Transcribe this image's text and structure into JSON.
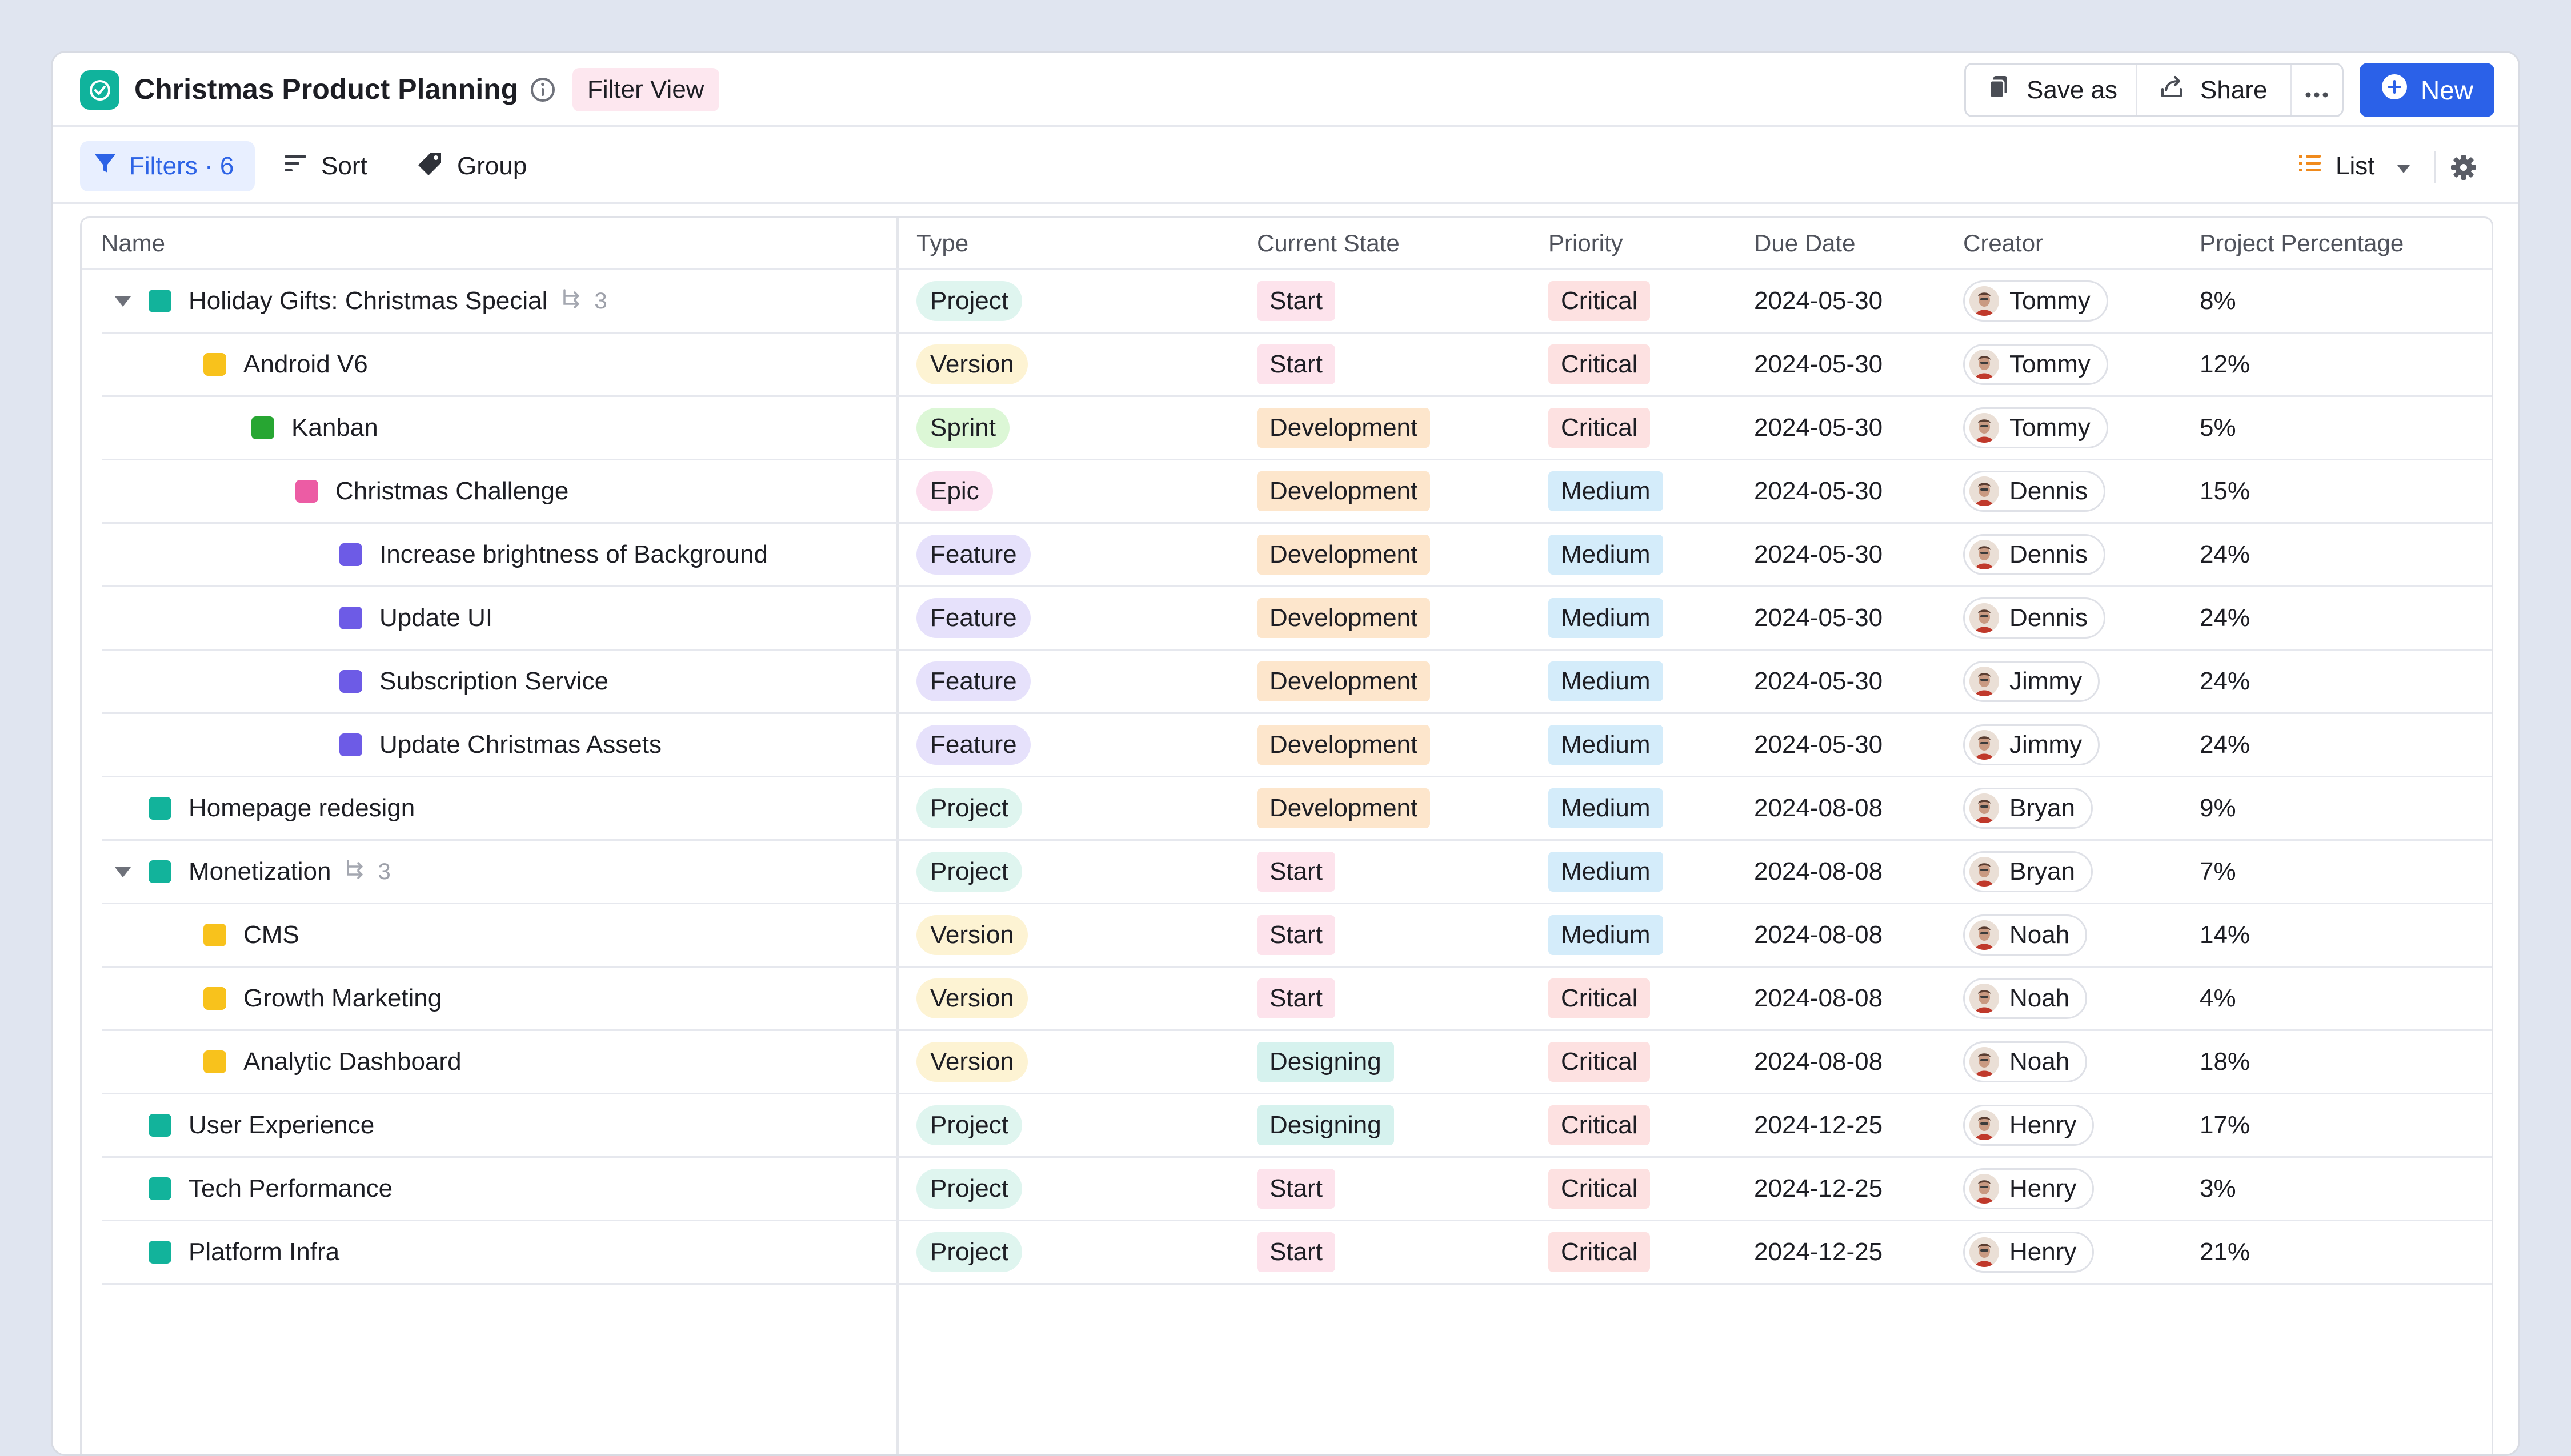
{
  "header": {
    "title": "Christmas Product Planning",
    "view_label": "Filter View",
    "save_as": "Save as",
    "share": "Share",
    "new": "New",
    "accent": "#2b61e8",
    "app_color": "#10b39c"
  },
  "toolbar": {
    "filters": "Filters · 6",
    "sort": "Sort",
    "group": "Group",
    "view": "List"
  },
  "columns": [
    "Name",
    "Type",
    "Current State",
    "Priority",
    "Due Date",
    "Creator",
    "Project Percentage"
  ],
  "styles": {
    "type": {
      "Project": {
        "bg": "#dff5ef",
        "fg": "#1d1e24",
        "square": "#12b39b"
      },
      "Version": {
        "bg": "#fdf3d3",
        "fg": "#1d1e24",
        "square": "#f8c21c"
      },
      "Sprint": {
        "bg": "#dcf7d6",
        "fg": "#1d1e24",
        "square": "#27a632"
      },
      "Epic": {
        "bg": "#fbe0ef",
        "fg": "#1d1e24",
        "square": "#ec5ca4"
      },
      "Feature": {
        "bg": "#e6e1fb",
        "fg": "#1d1e24",
        "square": "#6d5be6"
      }
    },
    "state": {
      "Start": "#fde3ec",
      "Development": "#fde6cc",
      "Designing": "#d6f2ee"
    },
    "priority": {
      "Critical": "#fde1e1",
      "Medium": "#d4ecfa"
    }
  },
  "rows": [
    {
      "name": "Holiday Gifts: Christmas Special",
      "level": 0,
      "expanded": true,
      "subcount": "3",
      "type": "Project",
      "state": "Start",
      "priority": "Critical",
      "due": "2024-05-30",
      "creator": "Tommy",
      "percent": "8%"
    },
    {
      "name": "Android V6",
      "level": 1,
      "type": "Version",
      "state": "Start",
      "priority": "Critical",
      "due": "2024-05-30",
      "creator": "Tommy",
      "percent": "12%"
    },
    {
      "name": "Kanban",
      "level": 2,
      "type": "Sprint",
      "state": "Development",
      "priority": "Critical",
      "due": "2024-05-30",
      "creator": "Tommy",
      "percent": "5%"
    },
    {
      "name": "Christmas Challenge",
      "level": 3,
      "type": "Epic",
      "state": "Development",
      "priority": "Medium",
      "due": "2024-05-30",
      "creator": "Dennis",
      "percent": "15%"
    },
    {
      "name": "Increase brightness of Background",
      "level": 4,
      "type": "Feature",
      "state": "Development",
      "priority": "Medium",
      "due": "2024-05-30",
      "creator": "Dennis",
      "percent": "24%"
    },
    {
      "name": "Update UI",
      "level": 4,
      "type": "Feature",
      "state": "Development",
      "priority": "Medium",
      "due": "2024-05-30",
      "creator": "Dennis",
      "percent": "24%"
    },
    {
      "name": "Subscription Service",
      "level": 4,
      "type": "Feature",
      "state": "Development",
      "priority": "Medium",
      "due": "2024-05-30",
      "creator": "Jimmy",
      "percent": "24%"
    },
    {
      "name": "Update Christmas Assets",
      "level": 4,
      "type": "Feature",
      "state": "Development",
      "priority": "Medium",
      "due": "2024-05-30",
      "creator": "Jimmy",
      "percent": "24%"
    },
    {
      "name": "Homepage redesign",
      "level": 0,
      "type": "Project",
      "state": "Development",
      "priority": "Medium",
      "due": "2024-08-08",
      "creator": "Bryan",
      "percent": "9%"
    },
    {
      "name": "Monetization",
      "level": 0,
      "expanded": true,
      "subcount": "3",
      "type": "Project",
      "state": "Start",
      "priority": "Medium",
      "due": "2024-08-08",
      "creator": "Bryan",
      "percent": "7%"
    },
    {
      "name": "CMS",
      "level": 1,
      "type": "Version",
      "state": "Start",
      "priority": "Medium",
      "due": "2024-08-08",
      "creator": "Noah",
      "percent": "14%"
    },
    {
      "name": "Growth Marketing",
      "level": 1,
      "type": "Version",
      "state": "Start",
      "priority": "Critical",
      "due": "2024-08-08",
      "creator": "Noah",
      "percent": "4%"
    },
    {
      "name": "Analytic Dashboard",
      "level": 1,
      "type": "Version",
      "state": "Designing",
      "priority": "Critical",
      "due": "2024-08-08",
      "creator": "Noah",
      "percent": "18%"
    },
    {
      "name": "User Experience",
      "level": 0,
      "type": "Project",
      "state": "Designing",
      "priority": "Critical",
      "due": "2024-12-25",
      "creator": "Henry",
      "percent": "17%"
    },
    {
      "name": "Tech Performance",
      "level": 0,
      "type": "Project",
      "state": "Start",
      "priority": "Critical",
      "due": "2024-12-25",
      "creator": "Henry",
      "percent": "3%"
    },
    {
      "name": "Platform Infra",
      "level": 0,
      "type": "Project",
      "state": "Start",
      "priority": "Critical",
      "due": "2024-12-25",
      "creator": "Henry",
      "percent": "21%"
    }
  ]
}
